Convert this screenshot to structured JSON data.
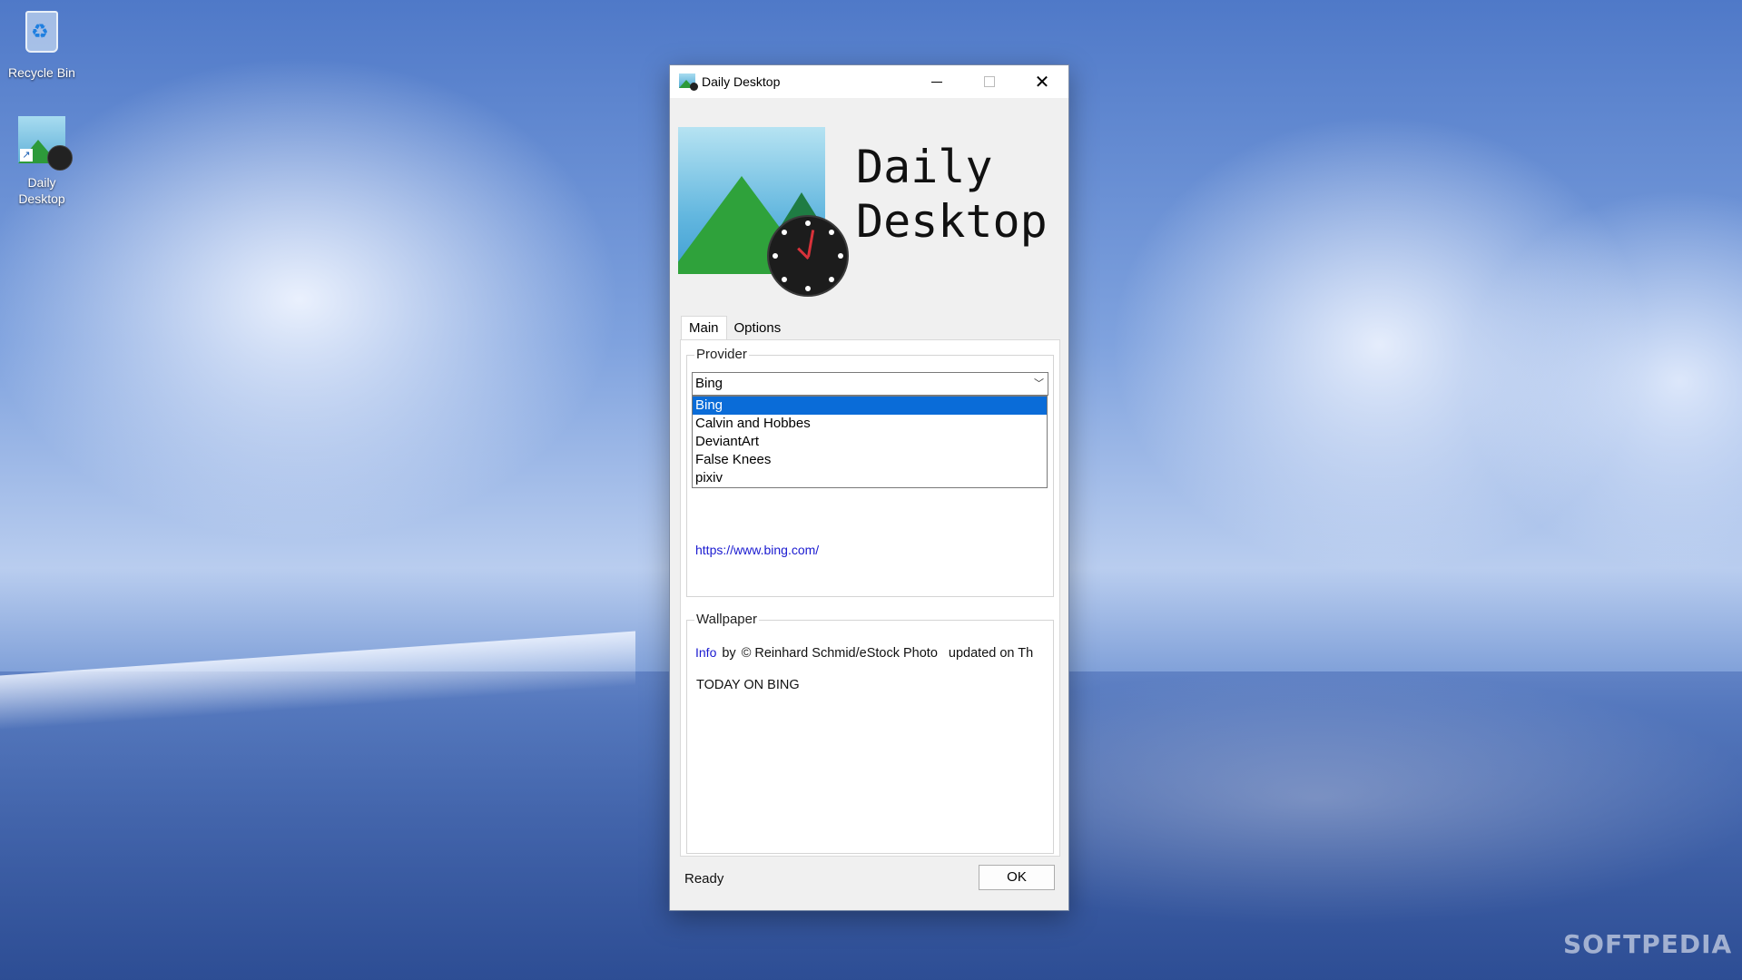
{
  "desktop": {
    "icons": [
      {
        "label": "Recycle Bin"
      },
      {
        "label": "Daily\nDesktop"
      }
    ],
    "watermark": "SOFTPEDIA"
  },
  "window": {
    "title": "Daily Desktop",
    "brand": "Daily\nDesktop",
    "tabs": [
      {
        "label": "Main",
        "active": true
      },
      {
        "label": "Options",
        "active": false
      }
    ],
    "provider": {
      "legend": "Provider",
      "selected": "Bing",
      "options": [
        "Bing",
        "Calvin and Hobbes",
        "DeviantArt",
        "False Knees",
        "pixiv"
      ],
      "url": "https://www.bing.com/"
    },
    "wallpaper": {
      "legend": "Wallpaper",
      "info_link": "Info",
      "by": "by",
      "author": "© Reinhard Schmid/eStock Photo",
      "updated": "updated on Th",
      "description": "TODAY ON BING"
    },
    "status": "Ready",
    "ok_label": "OK"
  },
  "colors": {
    "selection": "#0a6cd8",
    "link": "#1a1ad0"
  }
}
